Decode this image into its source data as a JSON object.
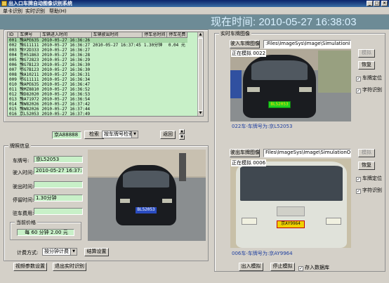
{
  "window": {
    "title": "出入口车牌自动图像识别系统"
  },
  "menu": [
    {
      "label": "单卡识别"
    },
    {
      "label": "实时识别"
    },
    {
      "label": "帮助(H)"
    }
  ],
  "header": {
    "clock": "现在时间: 2010-05-27 16:38:03"
  },
  "records": {
    "columns": [
      "ID",
      "车牌号",
      "车辆进入时间",
      "车辆驶出时间",
      "停车总时间",
      "停车花费"
    ],
    "rows": [
      [
        "001",
        "豫APE635",
        "2010-05-27 16:36:26",
        "",
        "",
        ""
      ],
      [
        "002",
        "豫G11111",
        "2010-05-27 16:36:27",
        "2010-05-27 16:37:45",
        "1.30分钟",
        "0.04 元"
      ],
      [
        "003",
        "豫Y2D333",
        "2010-05-27 16:36:27",
        "",
        "",
        ""
      ],
      [
        "004",
        "鲁H51863",
        "2010-05-27 16:36:28",
        "",
        "",
        ""
      ],
      [
        "005",
        "豫G72823",
        "2010-05-27 16:36:29",
        "",
        "",
        ""
      ],
      [
        "006",
        "豫G7B123",
        "2010-05-27 16:36:30",
        "",
        "",
        ""
      ],
      [
        "007",
        "鄂G7B123",
        "2010-05-27 16:36:30",
        "",
        "",
        ""
      ],
      [
        "008",
        "豫A10211",
        "2010-05-27 16:36:31",
        "",
        "",
        ""
      ],
      [
        "009",
        "鄂G11111",
        "2010-05-27 16:36:34",
        "",
        "",
        ""
      ],
      [
        "010",
        "豫APE635",
        "2010-05-27 16:36:47",
        "",
        "",
        ""
      ],
      [
        "011",
        "豫MZ8810",
        "2010-05-27 16:36:52",
        "",
        "",
        ""
      ],
      [
        "012",
        "豫D82020",
        "2010-05-27 16:36:53",
        "",
        "",
        ""
      ],
      [
        "013",
        "豫A71972",
        "2010-05-27 16:36:54",
        "",
        "",
        ""
      ],
      [
        "014",
        "豫W82026",
        "2010-05-27 16:37:42",
        "",
        "",
        ""
      ],
      [
        "015",
        "豫W82026",
        "2010-05-27 16:37:44",
        "",
        "",
        ""
      ],
      [
        "016",
        "京L52053",
        "2010-05-27 16:37:49",
        "",
        "",
        ""
      ]
    ]
  },
  "search": {
    "value": "京A88888",
    "button": "检索",
    "mode": "按车牌号检索",
    "back": "返回"
  },
  "info": {
    "legend": "牌照信息",
    "plate_label": "车牌号:",
    "plate_value": "京L52053",
    "entry_label": "驶入时间:",
    "entry_value": "2010-05-27 16:37:49",
    "exit_label": "驶出时间:",
    "exit_value": "",
    "duration_label": "停留时间:",
    "duration_value": "1.30分钟",
    "fee_label": "驻车费用:",
    "fee_value": "",
    "price_legend": "当前价格",
    "price_value": "每 60 分钟 2.00 元",
    "billing_label": "计费方式:",
    "billing_mode": "按分钟计费",
    "billing_button": "结算设置",
    "image_plate": "BL52053"
  },
  "bottom_buttons": {
    "video": "视频参数设置",
    "exit": "退出实时识别"
  },
  "realtime": {
    "legend": "实时车牌图像",
    "entry": {
      "button": "驶入车牌图像",
      "path": ":Files\\ImageSys\\Image\\SimulationIN\\5t",
      "status": "正在模拟 0022",
      "caption": "022车-车牌号为:京L52053",
      "plate_image": "BL52053",
      "simulate": "模拟",
      "restore": "恢复",
      "locate": "车牌定位",
      "recognize": "字符识别"
    },
    "exit": {
      "button": "驶出车牌图像",
      "path": "Files\\ImageSys\\Image\\SimulationOUT\\5t",
      "status": "正在模拟 0006",
      "caption": "006车-车牌号为:京AY9964",
      "plate_image": "京AY9964",
      "simulate": "模拟",
      "restore": "恢复",
      "locate": "车牌定位",
      "recognize": "字符识别"
    },
    "buttons": {
      "in_sim": "出入模拟",
      "stop_sim": "停止模拟",
      "store_db": "存入数据库"
    }
  },
  "colors": {
    "header": "#6d8b96",
    "clock": "#d8f0ff",
    "field": "#c8f0c8",
    "caption": "#2040a0"
  }
}
